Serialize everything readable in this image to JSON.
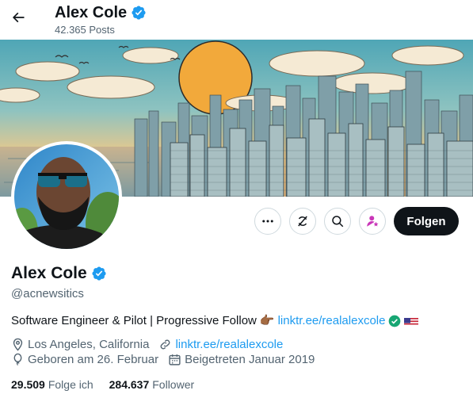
{
  "header": {
    "name": "Alex Cole",
    "posts": "42.365 Posts"
  },
  "profile": {
    "name": "Alex Cole",
    "handle": "@acnewsitics",
    "bio_text": "Software Engineer & Pilot | Progressive Follow",
    "bio_emoji": "👉🏾",
    "bio_link": "linktr.ee/realalexcole",
    "location": "Los Angeles, California",
    "website": "linktr.ee/realalexcole",
    "birthday": "Geboren am 26. Februar",
    "joined": "Beigetreten Januar 2019"
  },
  "actions": {
    "follow_label": "Folgen"
  },
  "stats": {
    "following_count": "29.509",
    "following_label": "Folge ich",
    "followers_count": "284.637",
    "followers_label": "Follower"
  },
  "colors": {
    "accent": "#1d9bf0",
    "text": "#0f1419",
    "muted": "#536471",
    "verified": "#1d9bf0"
  },
  "icons": [
    "back-arrow-icon",
    "verified-badge-icon",
    "more-icon",
    "retweet-off-icon",
    "search-icon",
    "subscribe-icon",
    "location-icon",
    "link-icon",
    "balloon-icon",
    "calendar-icon",
    "green-check-icon",
    "us-flag-icon"
  ]
}
